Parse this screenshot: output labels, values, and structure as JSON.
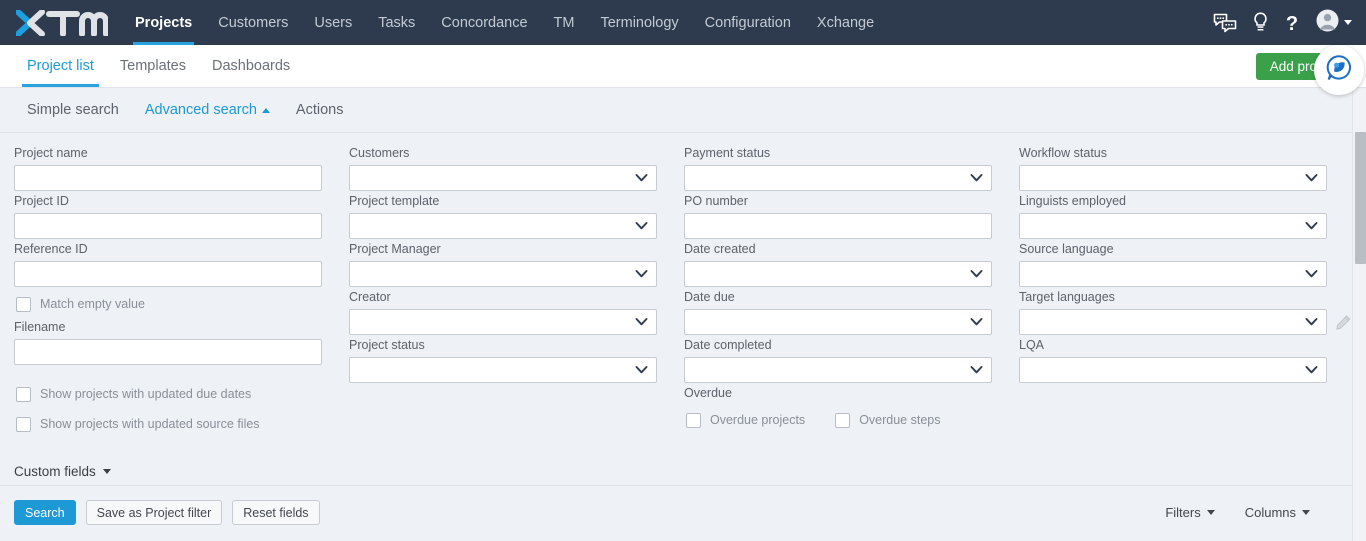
{
  "navbar": {
    "logo_text": "XTM",
    "items": [
      {
        "label": "Projects",
        "active": true
      },
      {
        "label": "Customers",
        "active": false
      },
      {
        "label": "Users",
        "active": false
      },
      {
        "label": "Tasks",
        "active": false
      },
      {
        "label": "Concordance",
        "active": false
      },
      {
        "label": "TM",
        "active": false
      },
      {
        "label": "Terminology",
        "active": false
      },
      {
        "label": "Configuration",
        "active": false
      },
      {
        "label": "Xchange",
        "active": false
      }
    ],
    "icons": [
      "chat-icon",
      "lightbulb-icon",
      "help-icon",
      "avatar-icon"
    ]
  },
  "subtabs": {
    "items": [
      {
        "label": "Project list",
        "active": true
      },
      {
        "label": "Templates",
        "active": false
      },
      {
        "label": "Dashboards",
        "active": false
      }
    ],
    "add_project_label": "Add project"
  },
  "searchbar": {
    "items": [
      {
        "label": "Simple search",
        "active": false
      },
      {
        "label": "Advanced search",
        "active": true
      },
      {
        "label": "Actions",
        "active": false
      }
    ]
  },
  "form": {
    "col1": {
      "project_name": {
        "label": "Project name",
        "value": "",
        "placeholder": ""
      },
      "project_id": {
        "label": "Project ID",
        "value": "",
        "placeholder": ""
      },
      "reference_id": {
        "label": "Reference ID",
        "value": "",
        "placeholder": ""
      },
      "match_empty_value": {
        "label": "Match empty value",
        "checked": false
      },
      "filename": {
        "label": "Filename",
        "value": "",
        "placeholder": ""
      },
      "updated_due_dates": {
        "label": "Show projects with updated due dates",
        "checked": false
      },
      "updated_source_files": {
        "label": "Show projects with updated source files",
        "checked": false
      }
    },
    "col2": {
      "customers": {
        "label": "Customers",
        "value": ""
      },
      "project_template": {
        "label": "Project template",
        "value": ""
      },
      "project_manager": {
        "label": "Project Manager",
        "value": ""
      },
      "creator": {
        "label": "Creator",
        "value": ""
      },
      "project_status": {
        "label": "Project status",
        "value": ""
      }
    },
    "col3": {
      "payment_status": {
        "label": "Payment status",
        "value": ""
      },
      "po_number": {
        "label": "PO number",
        "value": "",
        "placeholder": ""
      },
      "date_created": {
        "label": "Date created",
        "value": ""
      },
      "date_due": {
        "label": "Date due",
        "value": ""
      },
      "date_completed": {
        "label": "Date completed",
        "value": ""
      },
      "overdue": {
        "label": "Overdue",
        "projects": {
          "label": "Overdue projects",
          "checked": false
        },
        "steps": {
          "label": "Overdue steps",
          "checked": false
        }
      }
    },
    "col4": {
      "workflow_status": {
        "label": "Workflow status",
        "value": ""
      },
      "linguists_employed": {
        "label": "Linguists employed",
        "value": ""
      },
      "source_language": {
        "label": "Source language",
        "value": ""
      },
      "target_languages": {
        "label": "Target languages",
        "value": "",
        "edit_icon": "pencil-icon"
      },
      "lqa": {
        "label": "LQA",
        "value": ""
      }
    },
    "custom_fields_label": "Custom fields"
  },
  "bottom": {
    "search_label": "Search",
    "save_filter_label": "Save as Project filter",
    "reset_label": "Reset fields",
    "filters_label": "Filters",
    "columns_label": "Columns"
  },
  "colors": {
    "navbar_bg": "#2e3b4e",
    "accent_blue": "#1d9ad6",
    "tab_underline": "#29a3dd",
    "add_project_green": "#3aa14a",
    "page_bg": "#eef1f5"
  }
}
